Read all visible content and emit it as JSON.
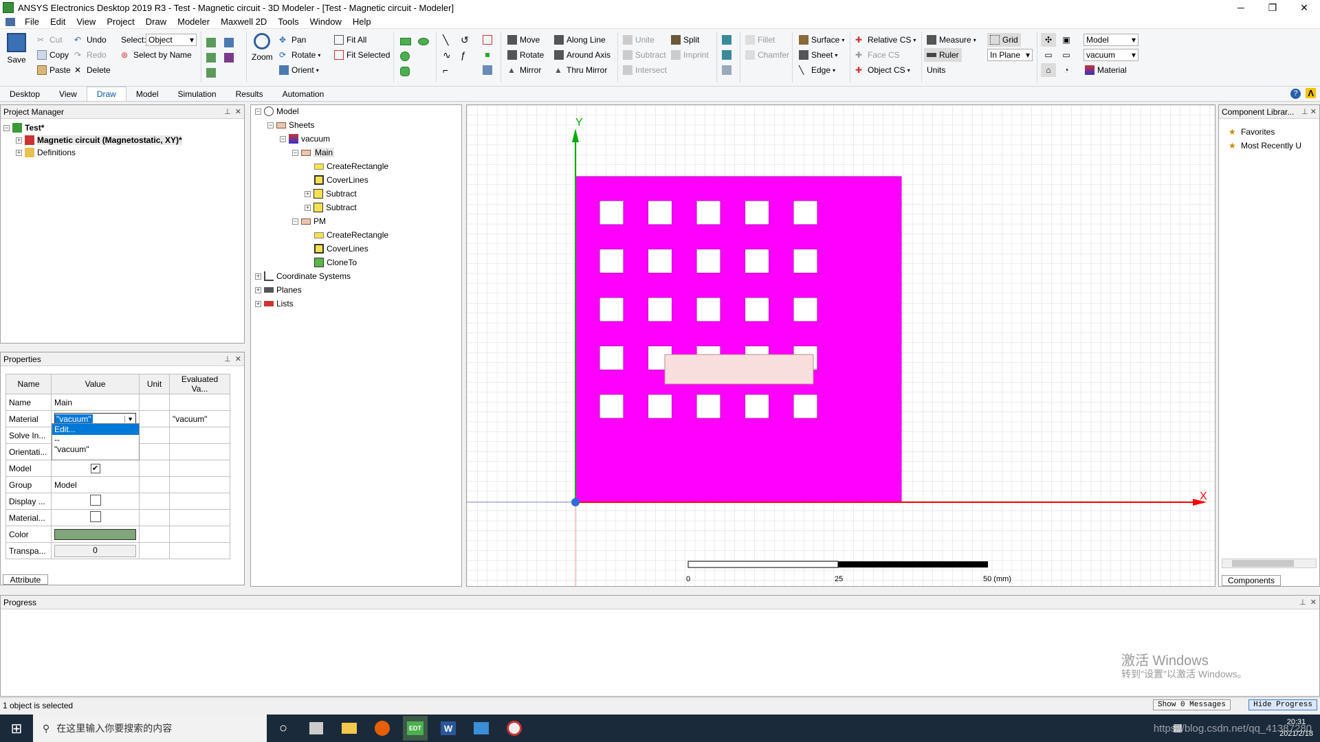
{
  "window": {
    "title": "ANSYS Electronics Desktop 2019 R3 - Test - Magnetic circuit - 3D Modeler - [Test - Magnetic circuit - Modeler]",
    "minimize": "─",
    "restore": "❐",
    "close": "✕"
  },
  "menu": [
    "File",
    "Edit",
    "View",
    "Project",
    "Draw",
    "Modeler",
    "Maxwell 2D",
    "Tools",
    "Window",
    "Help"
  ],
  "ribbon": {
    "save": "Save",
    "cut": "Cut",
    "copy": "Copy",
    "paste": "Paste",
    "undo": "Undo",
    "redo": "Redo",
    "delete": "Delete",
    "select_label": "Select:",
    "select_value": "Object",
    "select_by_name": "Select by Name",
    "zoom": "Zoom",
    "pan": "Pan",
    "rotate": "Rotate",
    "orient": "Orient",
    "fit_all": "Fit All",
    "fit_selected": "Fit Selected",
    "move": "Move",
    "rotate2": "Rotate",
    "mirror": "Mirror",
    "along_line": "Along Line",
    "around_axis": "Around Axis",
    "thru_mirror": "Thru Mirror",
    "unite": "Unite",
    "subtract": "Subtract",
    "intersect": "Intersect",
    "split": "Split",
    "imprint": "Imprint",
    "fillet": "Fillet",
    "chamfer": "Chamfer",
    "surface": "Surface",
    "sheet": "Sheet",
    "edge": "Edge",
    "relative_cs": "Relative CS",
    "face_cs": "Face CS",
    "object_cs": "Object CS",
    "measure": "Measure",
    "ruler": "Ruler",
    "units": "Units",
    "grid": "Grid",
    "in_plane": "In Plane",
    "model_combo": "Model",
    "material_combo": "vacuum",
    "material": "Material"
  },
  "tabs": [
    "Desktop",
    "View",
    "Draw",
    "Model",
    "Simulation",
    "Results",
    "Automation"
  ],
  "active_tab": "Draw",
  "project_manager": {
    "title": "Project Manager",
    "root": "Test*",
    "design": "Magnetic circuit (Magnetostatic, XY)*",
    "definitions": "Definitions"
  },
  "model_tree": {
    "model": "Model",
    "sheets": "Sheets",
    "vacuum": "vacuum",
    "main": "Main",
    "create_rect": "CreateRectangle",
    "cover_lines": "CoverLines",
    "subtract1": "Subtract",
    "subtract2": "Subtract",
    "pm": "PM",
    "create_rect2": "CreateRectangle",
    "cover_lines2": "CoverLines",
    "clone_to": "CloneTo",
    "coord": "Coordinate Systems",
    "planes": "Planes",
    "lists": "Lists"
  },
  "properties": {
    "title": "Properties",
    "headers": [
      "Name",
      "Value",
      "Unit",
      "Evaluated Va..."
    ],
    "rows": [
      {
        "name": "Name",
        "value": "Main",
        "unit": "",
        "eval": ""
      },
      {
        "name": "Material",
        "value": "\"vacuum\"",
        "unit": "",
        "eval": "\"vacuum\""
      },
      {
        "name": "Solve In...",
        "value": "",
        "unit": "",
        "eval": ""
      },
      {
        "name": "Orientati...",
        "value": "",
        "unit": "",
        "eval": ""
      },
      {
        "name": "Model",
        "value": "✔",
        "unit": "",
        "eval": ""
      },
      {
        "name": "Group",
        "value": "Model",
        "unit": "",
        "eval": ""
      },
      {
        "name": "Display ...",
        "value": "",
        "unit": "",
        "eval": ""
      },
      {
        "name": "Material...",
        "value": "",
        "unit": "",
        "eval": ""
      },
      {
        "name": "Color",
        "value": "",
        "unit": "",
        "eval": ""
      },
      {
        "name": "Transpa...",
        "value": "0",
        "unit": "",
        "eval": ""
      }
    ],
    "dropdown": [
      "Edit...",
      "--",
      "\"vacuum\""
    ],
    "attribute_tab": "Attribute"
  },
  "component_library": {
    "title": "Component Librar...",
    "favorites": "Favorites",
    "recent": "Most Recently U",
    "tab": "Components"
  },
  "viewport": {
    "axis_y": "Y",
    "axis_x": "X",
    "scale_labels": [
      "0",
      "25",
      "50 (mm)"
    ],
    "magenta": "#ff00ff",
    "pm_fill": "#f9dede"
  },
  "progress": {
    "title": "Progress",
    "watermark1": "激活 Windows",
    "watermark2": "转到\"设置\"以激活 Windows。"
  },
  "status": {
    "text": "1 object is selected",
    "show_messages": "Show 0 Messages",
    "hide_progress": "Hide Progress"
  },
  "taskbar": {
    "search_placeholder": "在这里输入你要搜索的内容",
    "time": "20:31",
    "date": "2021/2/18",
    "url": "https://blog.csdn.net/qq_41387280"
  }
}
